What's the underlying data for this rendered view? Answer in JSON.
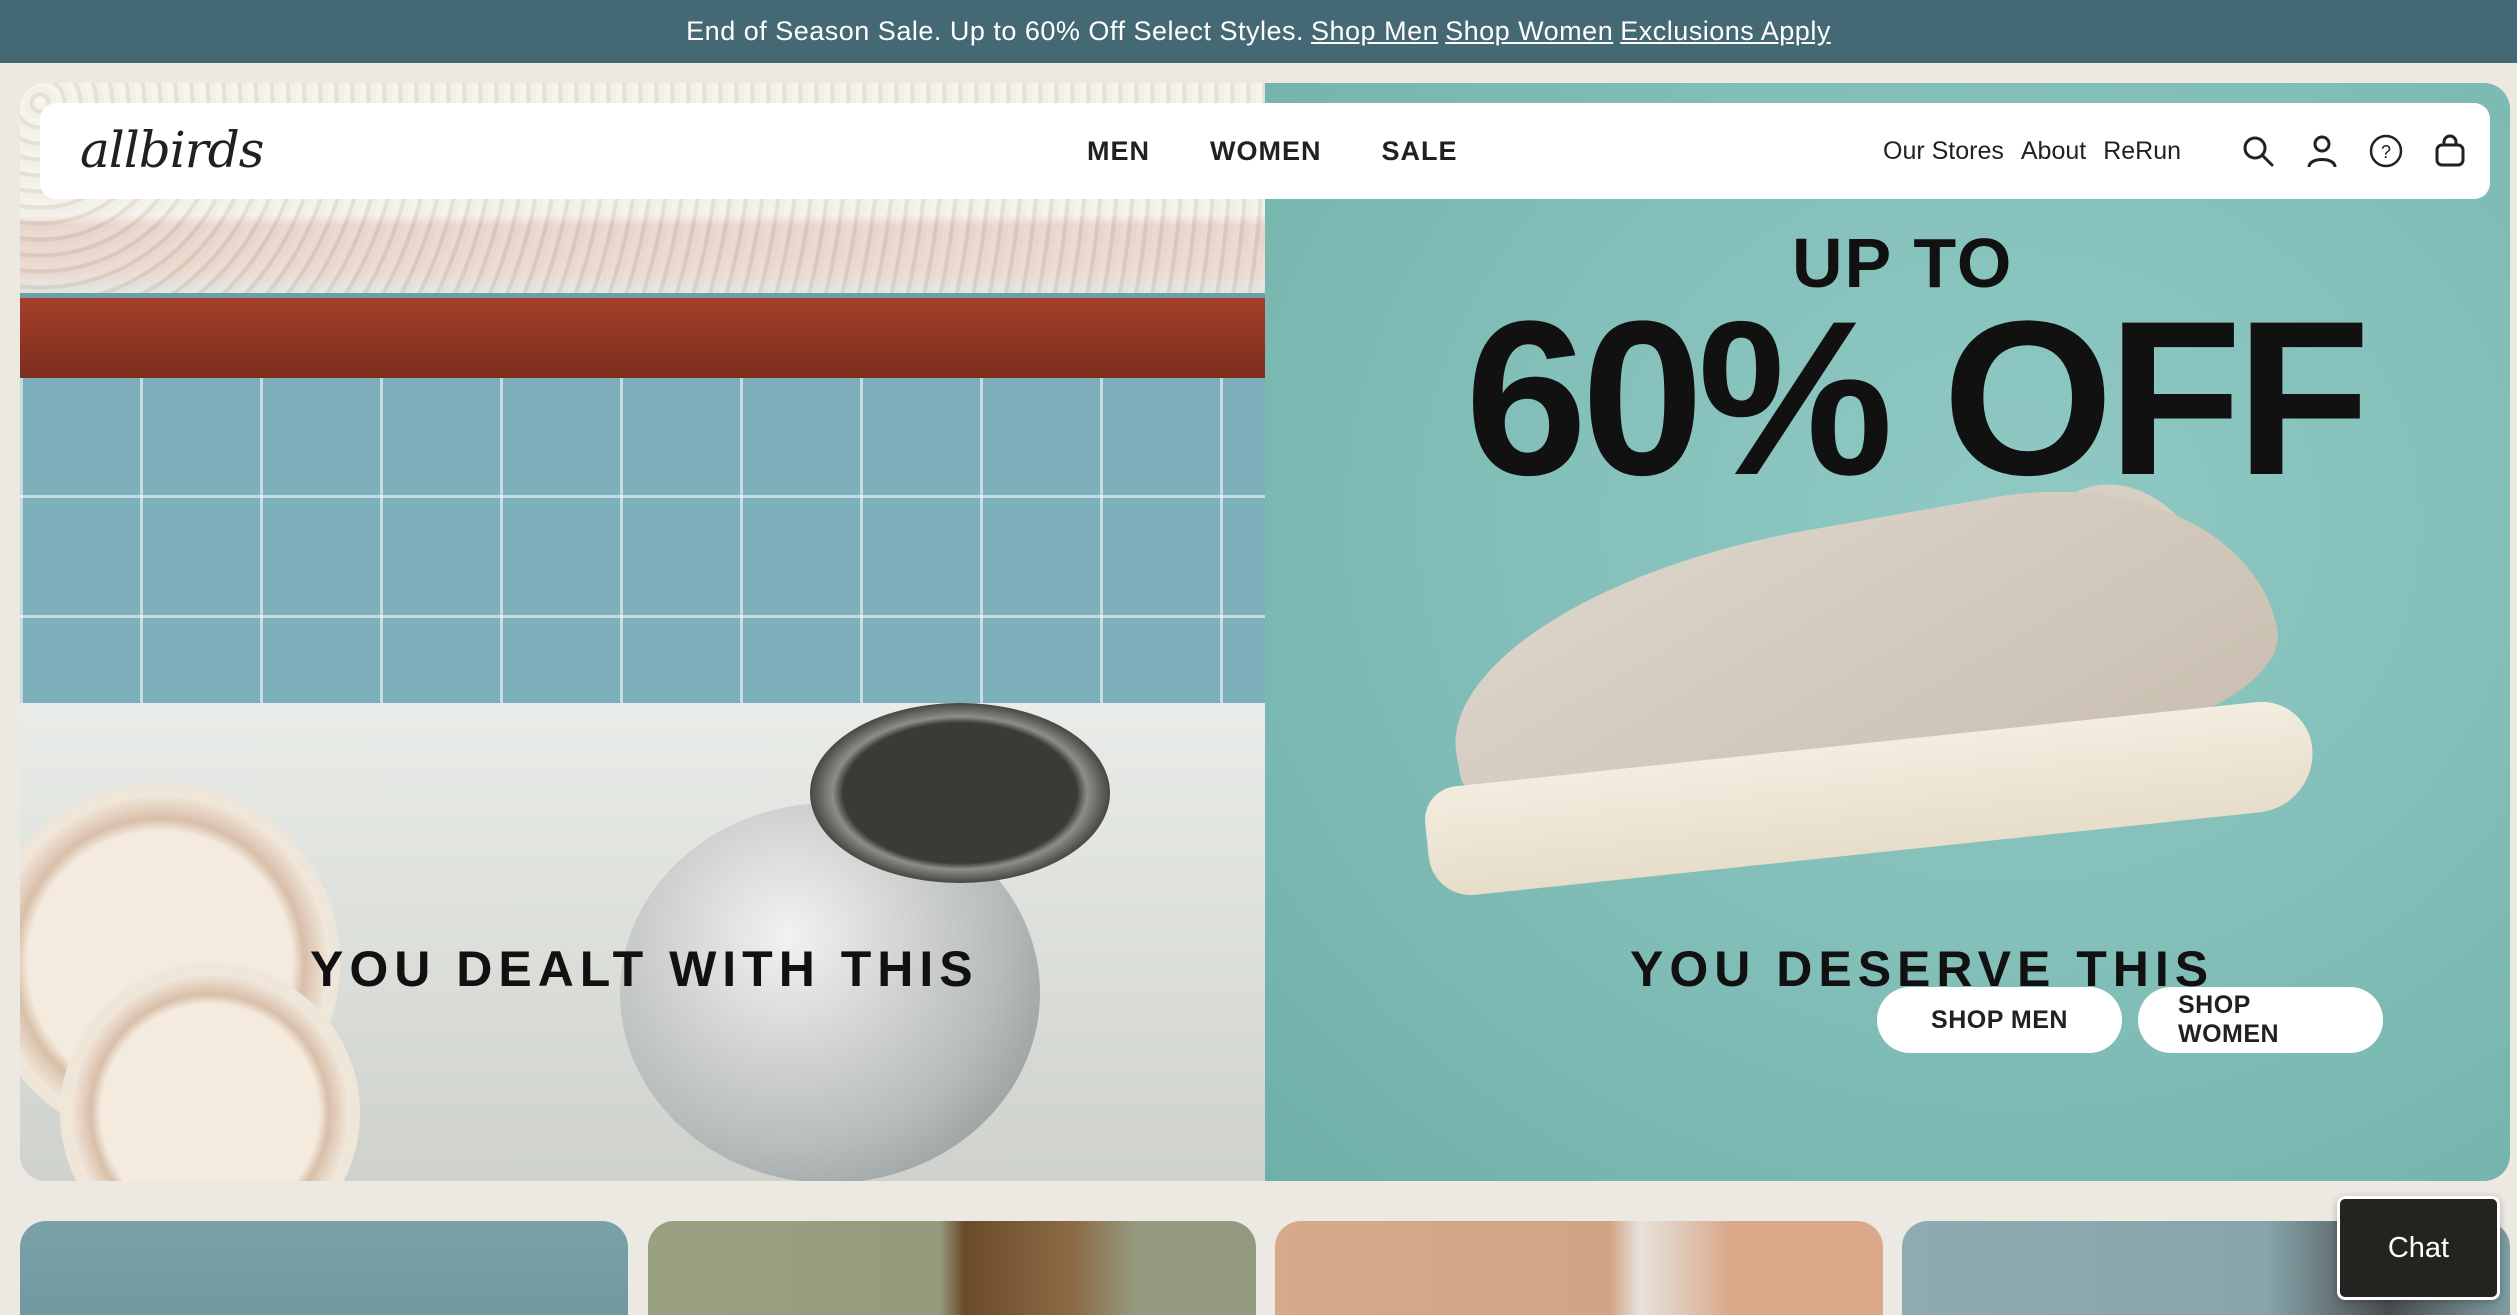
{
  "promo": {
    "message": "End of Season Sale. Up to 60% Off Select Styles.",
    "links": [
      "Shop Men",
      "Shop Women",
      "Exclusions Apply"
    ],
    "bg": "#456974"
  },
  "header": {
    "logo": "allbirds",
    "nav_main": [
      "MEN",
      "WOMEN",
      "SALE"
    ],
    "nav_right": [
      "Our Stores",
      "About",
      "ReRun"
    ],
    "icons": [
      "search-icon",
      "account-icon",
      "help-icon",
      "cart-icon"
    ]
  },
  "hero": {
    "left_tagline": "YOU DEALT WITH THIS",
    "right_tagline": "YOU DESERVE THIS",
    "up_to": "UP TO",
    "discount": "60% OFF",
    "cta_men": "SHOP MEN",
    "cta_women": "SHOP WOMEN",
    "right_bg": "#83bfb9"
  },
  "chat": {
    "label": "Chat"
  }
}
